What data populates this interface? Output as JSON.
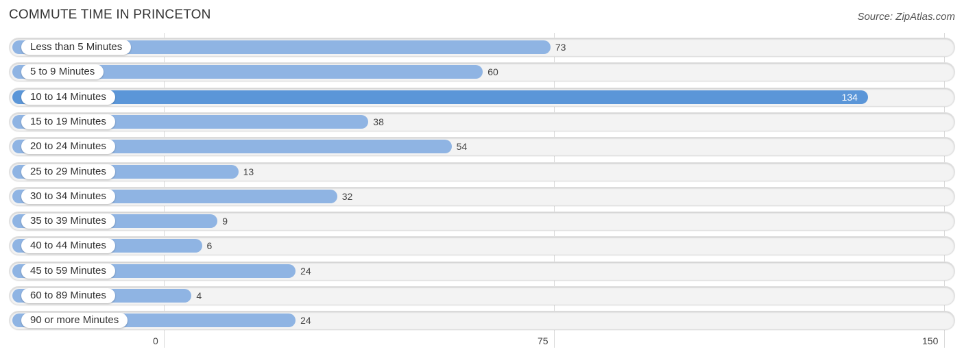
{
  "header": {
    "title": "COMMUTE TIME IN PRINCETON",
    "source": "Source: ZipAtlas.com"
  },
  "colors": {
    "bar_default": "#8fb4e3",
    "bar_highlight": "#5b96d8",
    "track": "#f3f3f3"
  },
  "chart_data": {
    "type": "bar",
    "orientation": "horizontal",
    "title": "COMMUTE TIME IN PRINCETON",
    "source": "Source: ZipAtlas.com",
    "xlabel": "",
    "ylabel": "",
    "xlim": [
      0,
      150
    ],
    "ticks": [
      "0",
      "75",
      "150"
    ],
    "tick_values": [
      0,
      75,
      150
    ],
    "grid": true,
    "categories": [
      "Less than 5 Minutes",
      "5 to 9 Minutes",
      "10 to 14 Minutes",
      "15 to 19 Minutes",
      "20 to 24 Minutes",
      "25 to 29 Minutes",
      "30 to 34 Minutes",
      "35 to 39 Minutes",
      "40 to 44 Minutes",
      "45 to 59 Minutes",
      "60 to 89 Minutes",
      "90 or more Minutes"
    ],
    "values": [
      73,
      60,
      134,
      38,
      54,
      13,
      32,
      9,
      6,
      24,
      4,
      24
    ],
    "value_labels": [
      "73",
      "60",
      "134",
      "38",
      "54",
      "13",
      "32",
      "9",
      "6",
      "24",
      "4",
      "24"
    ],
    "highlight_index": 2
  }
}
